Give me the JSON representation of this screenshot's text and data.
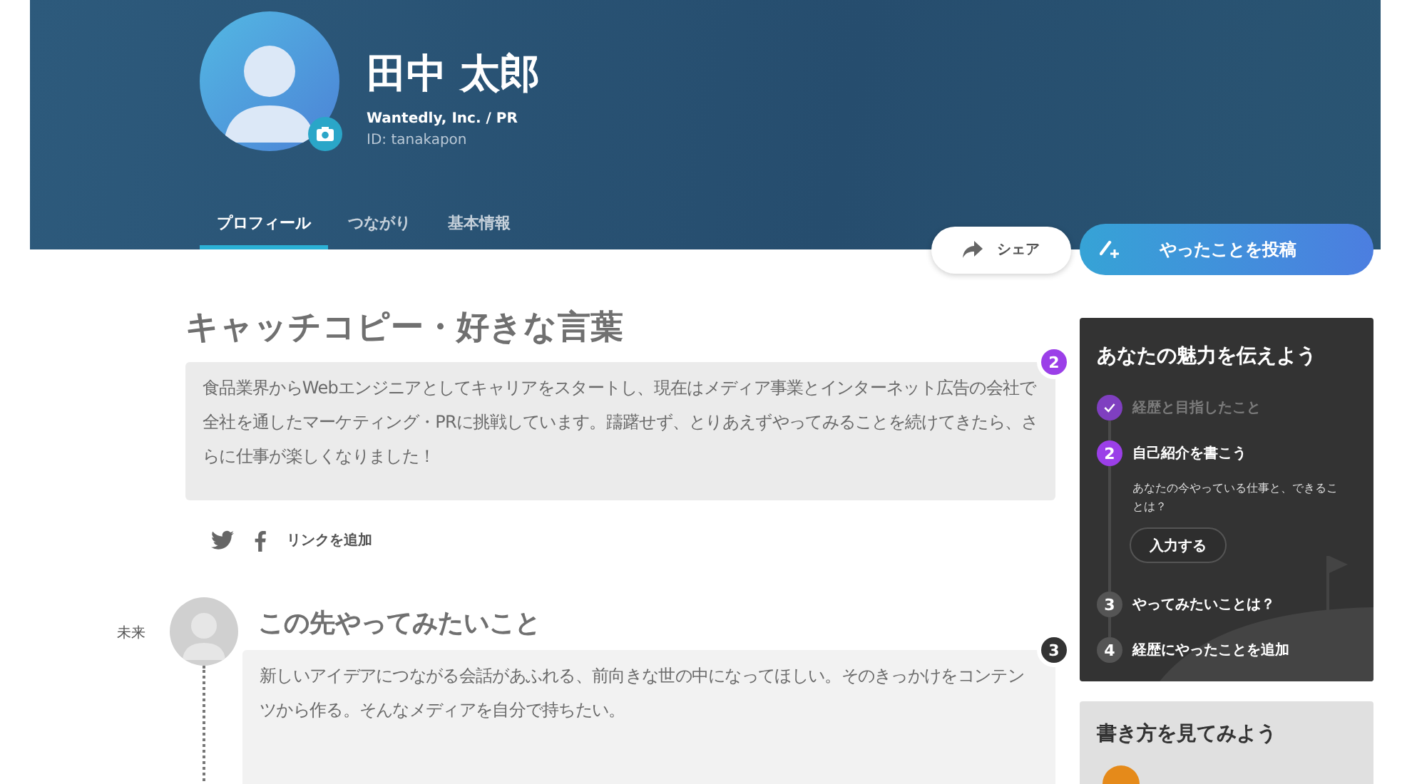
{
  "profile": {
    "name": "田中 太郎",
    "company": "Wantedly, Inc. / PR",
    "user_id": "ID: tanakapon"
  },
  "tabs": [
    {
      "label": "プロフィール",
      "selected": true
    },
    {
      "label": "つながり",
      "selected": false
    },
    {
      "label": "基本情報",
      "selected": false
    }
  ],
  "actions": {
    "share": "シェア",
    "post": "やったことを投稿"
  },
  "catchcopy": {
    "title": "キャッチコピー・好きな言葉",
    "text": "食品業界からWebエンジニアとしてキャリアをスタートし、現在はメディア事業とインターネット広告の会社で全社を通したマーケティング・PRに挑戦しています。躊躇せず、とりあえずやってみることを続けてきたら、さらに仕事が楽しくなりました！",
    "badge": {
      "label": "2",
      "color": "#9b3fe8"
    }
  },
  "links": {
    "add_label": "リンクを追加"
  },
  "timeline": [
    {
      "period": "未来",
      "title": "この先やってみたいこと",
      "text": "新しいアイデアにつながる会話があふれる、前向きな世の中になってほしい。そのきっかけをコンテンツから作る。そんなメディアを自分で持ちたい。",
      "badge": {
        "label": "3",
        "color": "#333333"
      }
    }
  ],
  "guide": {
    "title": "あなたの魅力を伝えよう",
    "steps": [
      {
        "kind": "done",
        "label": "経歴と目指したこと"
      },
      {
        "kind": "current",
        "number": "2",
        "label": "自己紹介を書こう",
        "hint": "あなたの今やっている仕事と、できることは？",
        "button": "入力する"
      },
      {
        "kind": "todo",
        "number": "3",
        "label": "やってみたいことは？"
      },
      {
        "kind": "todo",
        "number": "4",
        "label": "経歴にやったことを追加"
      }
    ]
  },
  "examples": {
    "title": "書き方を見てみよう"
  }
}
